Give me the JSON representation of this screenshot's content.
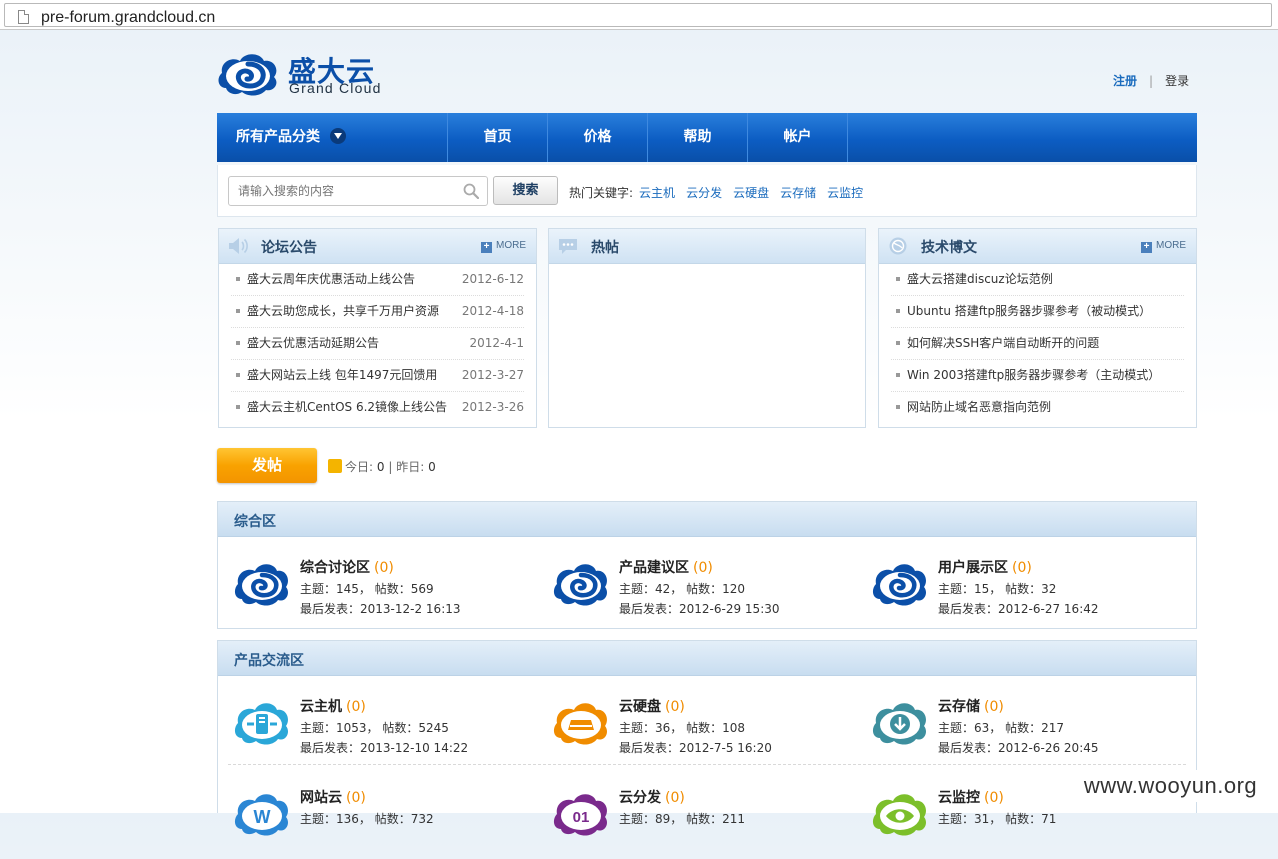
{
  "browser": {
    "url": "pre-forum.grandcloud.cn"
  },
  "header": {
    "logo_cn": "盛大云",
    "logo_en": "Grand Cloud",
    "register": "注册",
    "separator": "|",
    "login": "登录"
  },
  "nav": {
    "category": "所有产品分类",
    "items": [
      {
        "label": "首页"
      },
      {
        "label": "价格"
      },
      {
        "label": "帮助"
      },
      {
        "label": "帐户"
      }
    ]
  },
  "search": {
    "placeholder": "请输入搜索的内容",
    "button": "搜索",
    "hot_label": "热门关键字:",
    "keywords": [
      "云主机",
      "云分发",
      "云硬盘",
      "云存储",
      "云监控"
    ]
  },
  "panels": {
    "announcements": {
      "title": "论坛公告",
      "more": "MORE",
      "items": [
        {
          "title": "盛大云周年庆优惠活动上线公告",
          "date": "2012-6-12"
        },
        {
          "title": "盛大云助您成长，共享千万用户资源",
          "date": "2012-4-18"
        },
        {
          "title": "盛大云优惠活动延期公告",
          "date": "2012-4-1"
        },
        {
          "title": "盛大网站云上线 包年1497元回馈用",
          "date": "2012-3-27"
        },
        {
          "title": "盛大云主机CentOS 6.2镜像上线公告",
          "date": "2012-3-26"
        }
      ]
    },
    "hot": {
      "title": "热帖"
    },
    "tech": {
      "title": "技术博文",
      "more": "MORE",
      "items": [
        {
          "title": "盛大云搭建discuz论坛范例"
        },
        {
          "title": "Ubuntu 搭建ftp服务器步骤参考（被动模式）"
        },
        {
          "title": "如何解决SSH客户端自动断开的问题"
        },
        {
          "title": "Win 2003搭建ftp服务器步骤参考（主动模式）"
        },
        {
          "title": "网站防止域名恶意指向范例"
        }
      ]
    }
  },
  "post": {
    "button": "发帖",
    "today_label": "今日:",
    "today": "0",
    "sep": "|",
    "yesterday_label": "昨日:",
    "yesterday": "0"
  },
  "sections": [
    {
      "title": "综合区",
      "forums": [
        {
          "name": "综合讨论区",
          "count": "(0)",
          "stats": "主题：145， 帖数：569",
          "last": "最后发表：2013-12-2 16:13",
          "icon": "grandcloud-logo-icon",
          "color": "#0b4fa8"
        },
        {
          "name": "产品建议区",
          "count": "(0)",
          "stats": "主题：42， 帖数：120",
          "last": "最后发表：2012-6-29 15:30",
          "icon": "grandcloud-logo-icon",
          "color": "#0b4fa8"
        },
        {
          "name": "用户展示区",
          "count": "(0)",
          "stats": "主题：15， 帖数：32",
          "last": "最后发表：2012-6-27 16:42",
          "icon": "grandcloud-logo-icon",
          "color": "#0b4fa8"
        }
      ]
    },
    {
      "title": "产品交流区",
      "forums": [
        {
          "name": "云主机",
          "count": "(0)",
          "stats": "主题：1053， 帖数：5245",
          "last": "最后发表：2013-12-10 14:22",
          "icon": "cloud-host-icon",
          "color": "#2aa7d8"
        },
        {
          "name": "云硬盘",
          "count": "(0)",
          "stats": "主题：36， 帖数：108",
          "last": "最后发表：2012-7-5 16:20",
          "icon": "cloud-disk-icon",
          "color": "#f08c00"
        },
        {
          "name": "云存储",
          "count": "(0)",
          "stats": "主题：63， 帖数：217",
          "last": "最后发表：2012-6-26 20:45",
          "icon": "cloud-storage-icon",
          "color": "#3d8f9e"
        },
        {
          "name": "网站云",
          "count": "(0)",
          "stats": "主题：136， 帖数：732",
          "icon": "website-cloud-icon",
          "color": "#2a86d4"
        },
        {
          "name": "云分发",
          "count": "(0)",
          "stats": "主题：89， 帖数：211",
          "icon": "cdn-icon",
          "color": "#7a2a8c"
        },
        {
          "name": "云监控",
          "count": "(0)",
          "stats": "主题：31， 帖数：71",
          "icon": "monitor-icon",
          "color": "#7cbf2a"
        }
      ]
    }
  ],
  "watermark": "www.wooyun.org"
}
